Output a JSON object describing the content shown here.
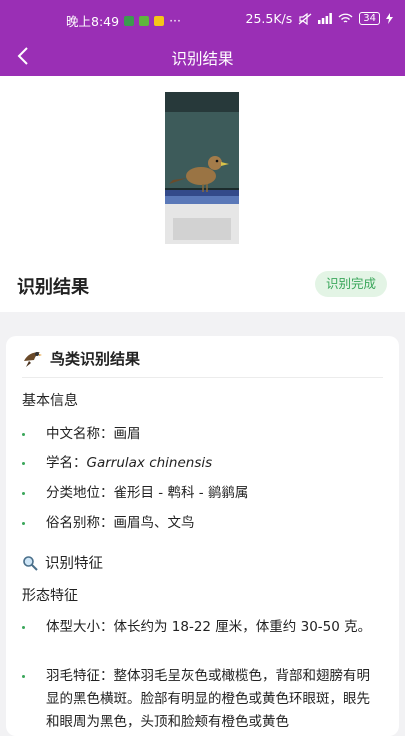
{
  "statusbar": {
    "time": "晚上8:49",
    "more": "···",
    "speed": "25.5K/s",
    "battery": "34"
  },
  "appbar": {
    "title": "识别结果"
  },
  "result": {
    "title": "识别结果",
    "badge": "识别完成"
  },
  "card": {
    "title": "鸟类识别结果",
    "basic_heading": "基本信息",
    "basic": [
      {
        "label": "中文名称：",
        "value": "画眉"
      },
      {
        "label": "学名：",
        "value": "Garrulax chinensis"
      },
      {
        "label": "分类地位：",
        "value": "雀形目 - 鹎科 - 鹟鹟属"
      },
      {
        "label": "俗名别称：",
        "value": "画眉鸟、文鸟"
      }
    ],
    "feature_heading": "识别特征",
    "morph_heading": "形态特征",
    "features": [
      {
        "label": "体型大小：",
        "value": "体长约为 18-22 厘米，体重约 30-50 克。"
      },
      {
        "label": "羽毛特征：",
        "value": "整体羽毛呈灰色或橄榄色，背部和翅膀有明显的黑色横斑。脸部有明显的橙色或黄色环眼斑，眼先和眼周为黑色，头顶和脸颊有橙色或黄色"
      }
    ]
  }
}
